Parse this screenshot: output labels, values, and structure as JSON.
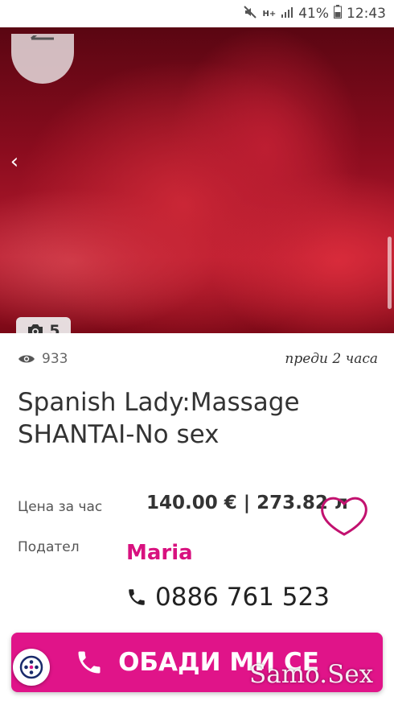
{
  "status_bar": {
    "signal_type": "H+",
    "battery": "41%",
    "time": "12:43"
  },
  "gallery": {
    "photo_count": "5"
  },
  "listing": {
    "views": "933",
    "posted": "преди 2 часа",
    "title": "Spanish Lady:Massage SHANTAI-No sex",
    "price_label": "Цена за час",
    "price_value": "140.00 € | 273.82 л",
    "seller_label": "Подател",
    "seller_name": "Maria",
    "phone": "0886 761 523"
  },
  "actions": {
    "call_label": "ОБАДИ МИ СЕ"
  },
  "watermark": "Samo.Sex",
  "colors": {
    "accent": "#e01489",
    "seller": "#d8117f"
  }
}
